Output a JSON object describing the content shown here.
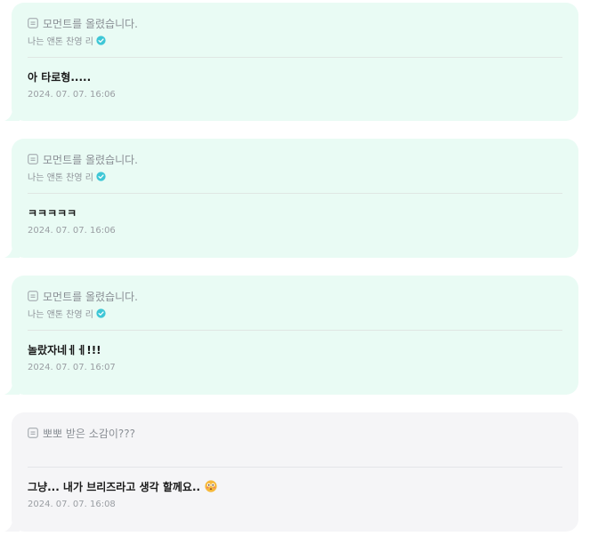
{
  "messages": [
    {
      "header": "모먼트를 올렸습니다.",
      "artist": "나는 앤톤 찬영 리",
      "text": "아 타로형.....",
      "time": "2024. 07. 07. 16:06",
      "style": "mint",
      "verified": true,
      "emoji": ""
    },
    {
      "header": "모먼트를 올렸습니다.",
      "artist": "나는 앤톤 찬영 리",
      "text": "ㅋㅋㅋㅋㅋ",
      "time": "2024. 07. 07. 16:06",
      "style": "mint",
      "verified": true,
      "emoji": ""
    },
    {
      "header": "모먼트를 올렸습니다.",
      "artist": "나는 앤톤 찬영 리",
      "text": "놀랐자네ㅔㅔ!!!",
      "time": "2024. 07. 07. 16:07",
      "style": "mint",
      "verified": true,
      "emoji": ""
    },
    {
      "header": "뽀뽀 받은 소감이???",
      "artist": "",
      "text": "그냥... 내가 브리즈라고 생각 할께요..",
      "time": "2024. 07. 07. 16:08",
      "style": "gray",
      "verified": false,
      "emoji": "flushed-face-icon"
    }
  ],
  "colors": {
    "mint_bubble": "#e9fbf4",
    "gray_bubble": "#f5f5f7",
    "verified_badge": "#3ec7d6",
    "text": "#1b1b1b",
    "muted": "#8a8f95"
  }
}
